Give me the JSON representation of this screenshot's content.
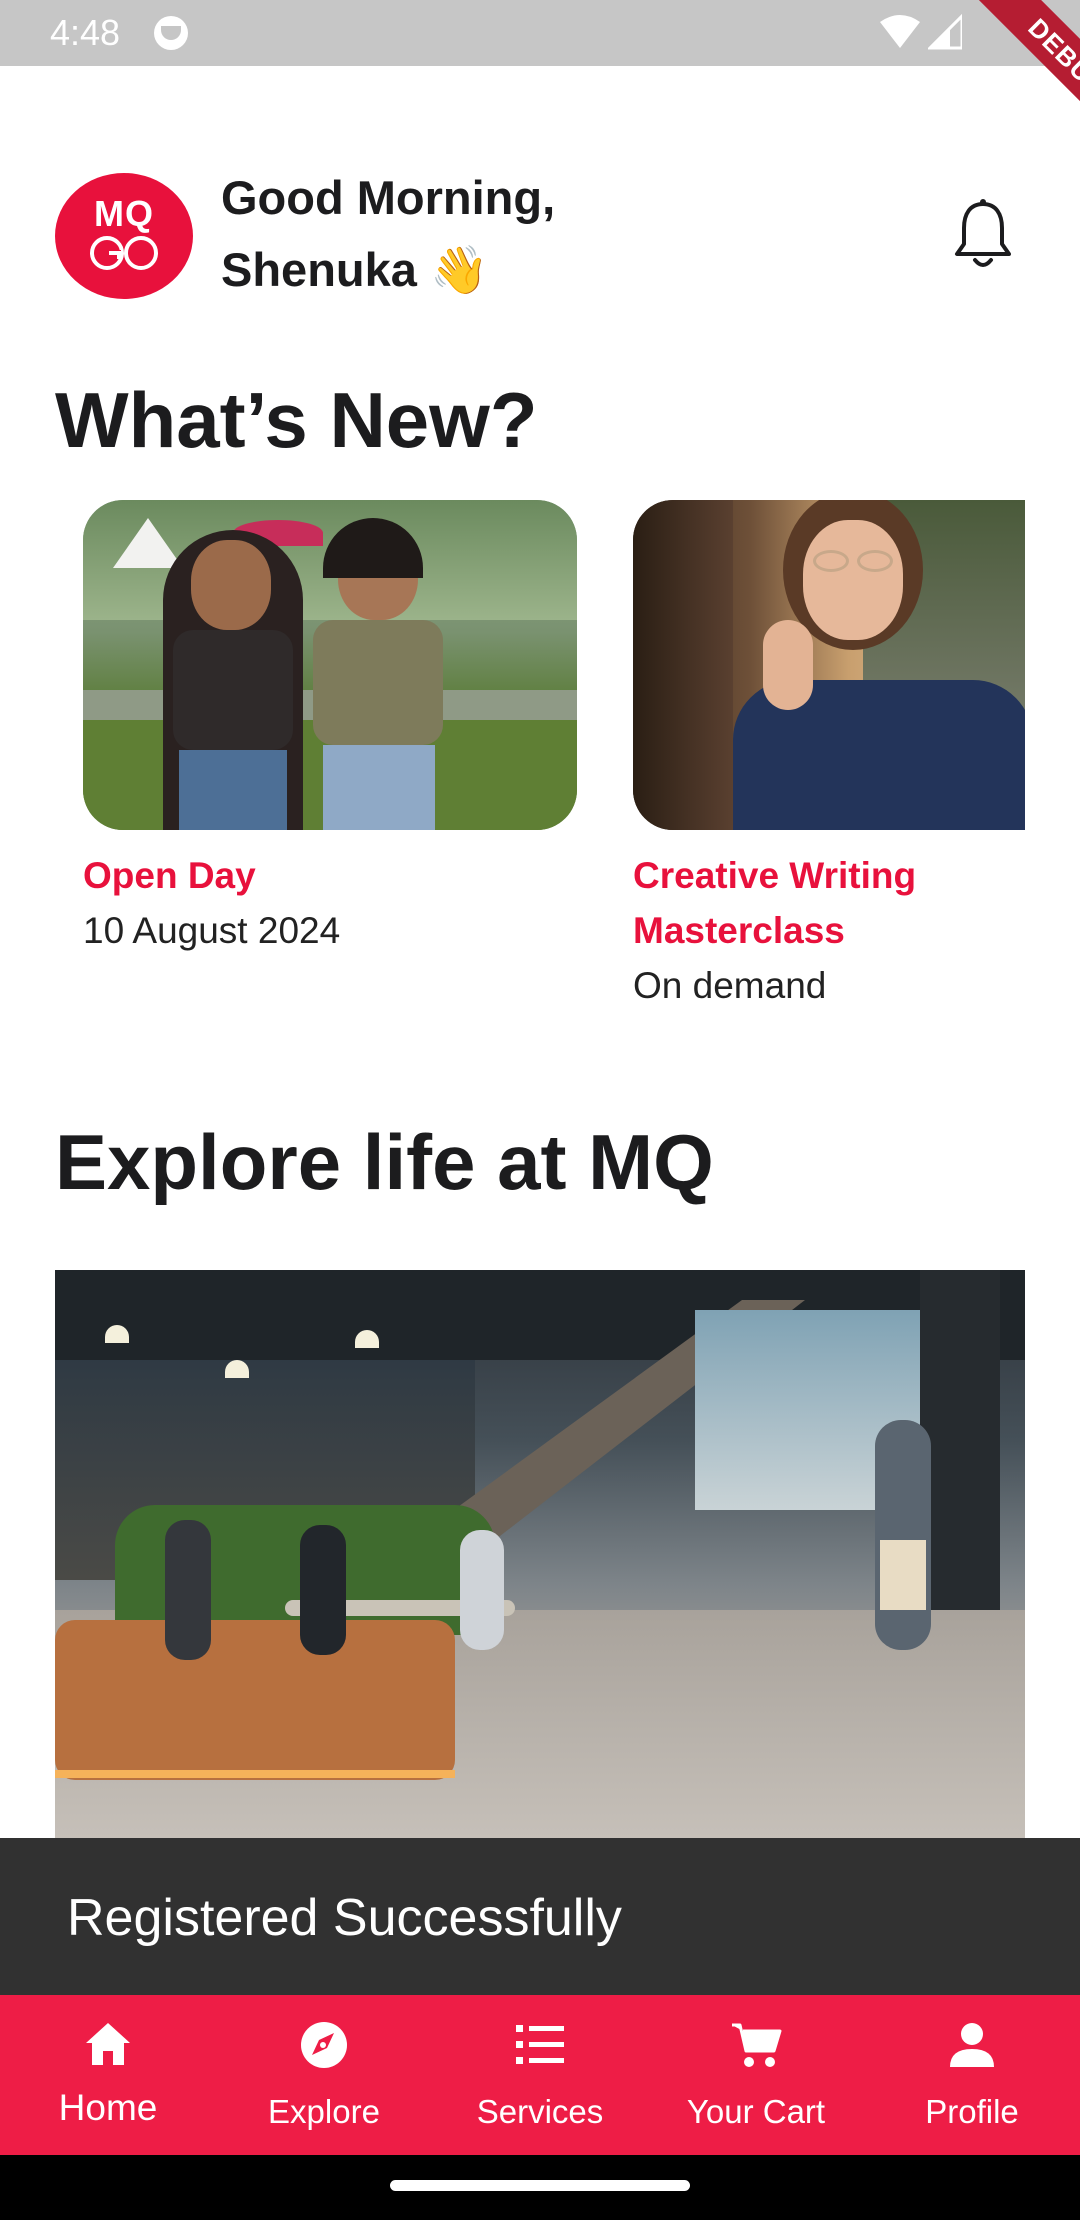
{
  "status_bar": {
    "time": "4:48"
  },
  "debug_banner": "DEBUG",
  "header": {
    "logo_text": "MQ",
    "greeting_line1": "Good Morning,",
    "greeting_line2": "Shenuka 👋"
  },
  "whats_new": {
    "title": "What’s New?",
    "cards": [
      {
        "title": "Open Day",
        "subtitle": "10 August 2024"
      },
      {
        "title": "Creative Writing Masterclass",
        "subtitle": "On demand"
      }
    ]
  },
  "explore": {
    "title": "Explore life at MQ"
  },
  "snackbar": {
    "message": "Registered Successfully"
  },
  "bottom_nav": {
    "active": "Home",
    "items": [
      {
        "label": "Home",
        "icon": "home-icon"
      },
      {
        "label": "Explore",
        "icon": "compass-icon"
      },
      {
        "label": "Services",
        "icon": "list-icon"
      },
      {
        "label": "Your Cart",
        "icon": "cart-icon"
      },
      {
        "label": "Profile",
        "icon": "person-icon"
      }
    ]
  },
  "colors": {
    "accent": "#e8113c",
    "nav_background": "#ee1d46",
    "snackbar_background": "#313131"
  }
}
